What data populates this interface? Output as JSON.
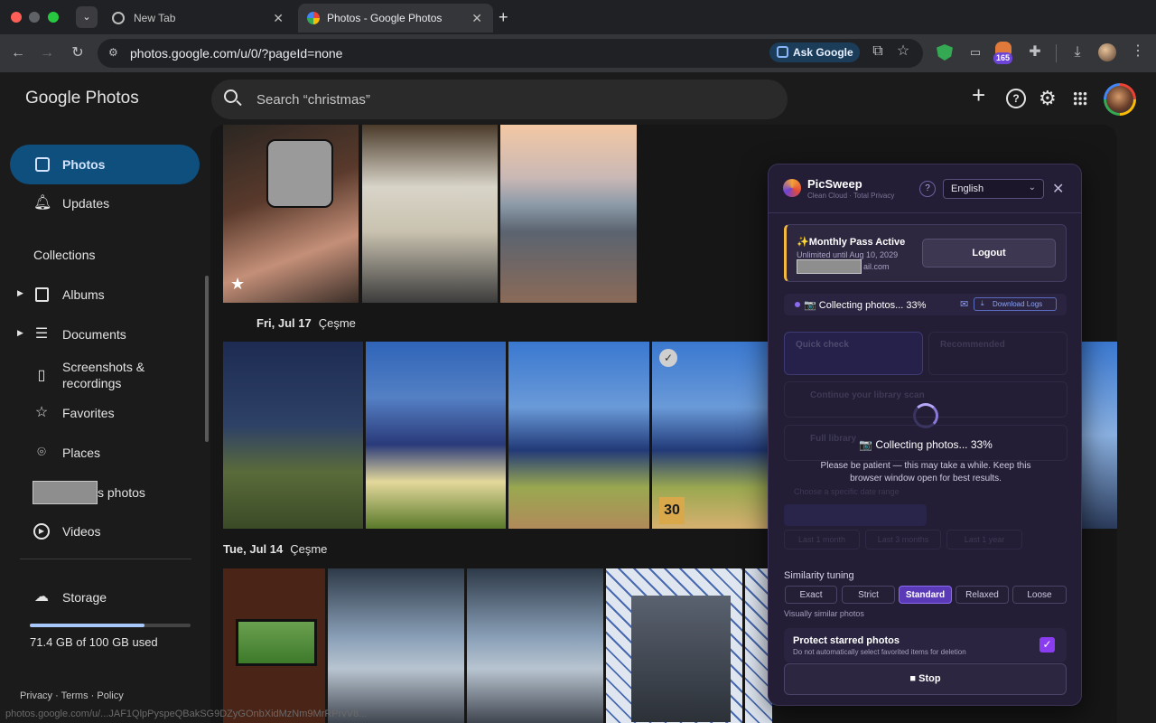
{
  "browser": {
    "tabs": [
      {
        "title": "New Tab"
      },
      {
        "title": "Photos - Google Photos"
      }
    ],
    "url": "photos.google.com/u/0/?pageId=none",
    "ask_google": "Ask Google",
    "extension_badge": "165",
    "status_url": "photos.google.com/u/...JAF1QlpPyspeQBakSG9DZyGOnbXidMzNm9MrRPrvV8..."
  },
  "app": {
    "logo": "Google Photos",
    "search_placeholder": "Search “christmas”"
  },
  "sidebar": {
    "photos": "Photos",
    "updates": "Updates",
    "collections": "Collections",
    "albums": "Albums",
    "documents": "Documents",
    "screenshots_1": "Screenshots &",
    "screenshots_2": "recordings",
    "favorites": "Favorites",
    "places": "Places",
    "people_suffix": "s photos",
    "videos": "Videos",
    "storage": "Storage",
    "storage_used": "71.4 GB of 100 GB used",
    "storage_fraction": 0.714,
    "footer": [
      "Privacy",
      "Terms",
      "Policy"
    ]
  },
  "timeline": {
    "groups": [
      {
        "date": "Fri, Jul 17",
        "place": "Çeşme"
      },
      {
        "date": "Tue, Jul 14",
        "place": "Çeşme"
      }
    ],
    "plate_number": "30"
  },
  "picsweep": {
    "title": "PicSweep",
    "subtitle": "Clean Cloud · Total Privacy",
    "language": "English",
    "pass_title": "✨Monthly Pass Active",
    "pass_until": "Unlimited until Aug 10, 2029",
    "pass_email_suffix": "ail.com",
    "logout": "Logout",
    "status": "📷 Collecting photos... 33%",
    "download_logs": "Download Logs",
    "dim_quick": "Quick check",
    "dim_recommended": "Recommended",
    "dim_continue": "Continue your library scan",
    "dim_full": "Full library",
    "dim_range": "Choose a specific date range",
    "dim_last1": "Last 1 month",
    "dim_last3": "Last 3 months",
    "dim_last12": "Last 1 year",
    "overlay_title": "📷 Collecting photos... 33%",
    "overlay_msg": "Please be patient — this may take a while. Keep this browser window open for best results.",
    "tuning_label": "Similarity tuning",
    "tuning_options": [
      "Exact",
      "Strict",
      "Standard",
      "Relaxed",
      "Loose"
    ],
    "tuning_selected": "Standard",
    "tuning_hint": "Visually similar photos",
    "protect_title": "Protect starred photos",
    "protect_desc": "Do not automatically select favorited items for deletion",
    "protect_checked": true,
    "stop": "■ Stop"
  },
  "colors": {
    "accent": "#0e4f7d",
    "panel": "#231d36",
    "purple": "#6d44d8"
  }
}
